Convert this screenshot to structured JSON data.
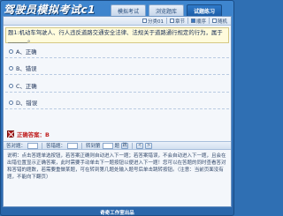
{
  "app": {
    "title": "驾驶员模拟考试c1"
  },
  "tabs": [
    {
      "label": "模拟考试",
      "active": false
    },
    {
      "label": "浏览题库",
      "active": false
    },
    {
      "label": "试题练习",
      "active": true
    }
  ],
  "options_bar": {
    "items": [
      {
        "label": "分类01",
        "checked": false
      },
      {
        "label": "章节",
        "checked": false
      },
      {
        "label": "顺序",
        "checked": true
      },
      {
        "label": "随机",
        "checked": false
      }
    ]
  },
  "question": {
    "text": "题1:机动车驾驶人、行人违反道路交通安全法律、法规关于道路通行规定的行为，属于_______。"
  },
  "answer_options": [
    {
      "label": "A、正确"
    },
    {
      "label": "B、错误"
    },
    {
      "label": "C、正确"
    },
    {
      "label": "D、错误"
    }
  ],
  "answer": {
    "text": "正确答案：B"
  },
  "nav": {
    "correct_label": "答对题：",
    "wrong_label": "答错题：",
    "jump_label": "转到第",
    "jump_suffix": "题",
    "go_button": "跳",
    "prev_button": "<",
    "next_button": ">"
  },
  "notes": {
    "text": "说明：点击答题单选按钮，若答案正确则自动进入下一题；若答案错误，不会自动进入下一题，且会在出错位置显示正确答案，此时需要手动单击下一题按钮以便进入下一题！您可以在答题的同时查看答对和答错的题数，若需要重做某题，可在转到第几题处输入题号后单击跳转按钮。（注意：当前页面没有题，不能向下翻页）"
  },
  "footer": {
    "text": "奇奇工作室出品"
  },
  "colors": {
    "frame": "#2f6fb3",
    "active_tab": "#1d5ea8",
    "question_bg": "#fffbdc",
    "answer_text": "#c02020"
  }
}
